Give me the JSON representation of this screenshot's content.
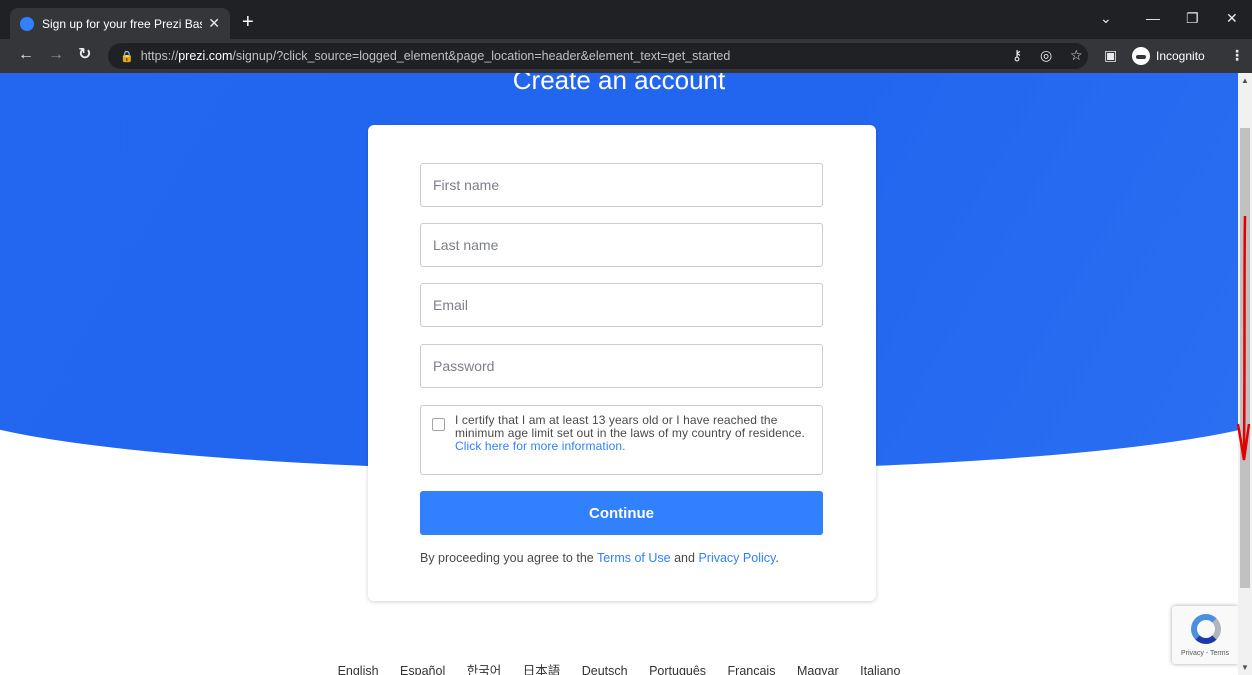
{
  "browser": {
    "tab_title": "Sign up for your free Prezi Basic",
    "url_scheme": "https://",
    "url_host": "prezi.com",
    "url_path": "/signup/?click_source=logged_element&page_location=header&element_text=get_started",
    "profile_label": "Incognito"
  },
  "page": {
    "heading": "Create an account",
    "form": {
      "first_name_placeholder": "First name",
      "last_name_placeholder": "Last name",
      "email_placeholder": "Email",
      "password_placeholder": "Password",
      "consent_text": "I certify that I am at least 13 years old or I have reached the minimum age limit set out in the laws of my country of residence.",
      "consent_link": "Click here for more information.",
      "continue_label": "Continue",
      "terms_prefix": "By proceeding you agree to the",
      "terms_link": "Terms of Use",
      "terms_and": "and",
      "privacy_link": "Privacy Policy",
      "terms_suffix": "."
    },
    "languages": [
      "English",
      "Español",
      "한국어",
      "日本語",
      "Deutsch",
      "Português",
      "Français",
      "Magyar",
      "Italiano"
    ],
    "recaptcha_text": "Privacy - Terms"
  },
  "colors": {
    "hero_blue": "#2366ef",
    "button_blue": "#3181ff",
    "annotation_red": "#e00000"
  }
}
